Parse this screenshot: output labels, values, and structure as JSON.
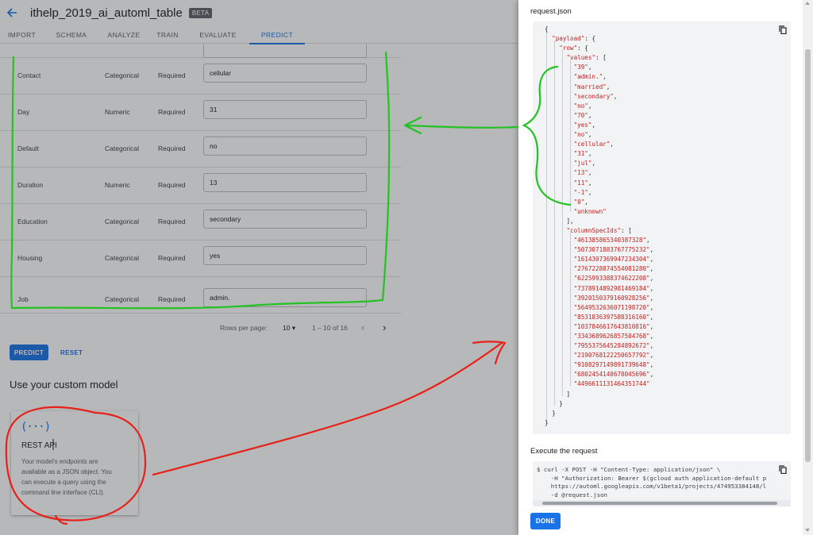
{
  "app": {
    "title": "ithelp_2019_ai_automl_table",
    "badge": "BETA",
    "tabs": [
      {
        "label": "IMPORT"
      },
      {
        "label": "SCHEMA"
      },
      {
        "label": "ANALYZE"
      },
      {
        "label": "TRAIN"
      },
      {
        "label": "EVALUATE"
      },
      {
        "label": "PREDICT",
        "active": true
      }
    ]
  },
  "fields": [
    {
      "name": "Contact",
      "type": "Categorical",
      "required": "Required",
      "value": "cellular"
    },
    {
      "name": "Day",
      "type": "Numeric",
      "required": "Required",
      "value": "31"
    },
    {
      "name": "Default",
      "type": "Categorical",
      "required": "Required",
      "value": "no"
    },
    {
      "name": "Duration",
      "type": "Numeric",
      "required": "Required",
      "value": "13"
    },
    {
      "name": "Education",
      "type": "Categorical",
      "required": "Required",
      "value": "secondary"
    },
    {
      "name": "Housing",
      "type": "Categorical",
      "required": "Required",
      "value": "yes"
    },
    {
      "name": "Job",
      "type": "Categorical",
      "required": "Required",
      "value": "admin."
    }
  ],
  "pagination": {
    "rows_per_page_label": "Rows per page:",
    "rows_per_page": "10",
    "range": "1 – 10 of 16"
  },
  "actions": {
    "predict": "PREDICT",
    "reset": "RESET"
  },
  "custom_model": {
    "title": "Use your custom model",
    "card_icon": "(···)",
    "card_title": "REST API",
    "card_desc": "Your model's endpoints are available as a JSON object. You can execute a query using the command line interface (CLI)."
  },
  "panel": {
    "title": "request.json",
    "json_values": [
      "39",
      "admin.",
      "married",
      "secondary",
      "no",
      "70",
      "yes",
      "no",
      "cellular",
      "31",
      "jul",
      "13",
      "11",
      "-1",
      "0",
      "unknown"
    ],
    "column_spec_ids": [
      "461385865340387328",
      "5073071883767775232",
      "1614307369947234304",
      "2767228874554081280",
      "6225993388374622208",
      "7378914892981469184",
      "3920150379160928256",
      "5649532636071198720",
      "8531836397588316160",
      "1037846617643810816",
      "3343689626857504768",
      "7955375645284892672",
      "2190768122250657792",
      "9108297149891739648",
      "6802454140678045696",
      "4496611131464351744"
    ],
    "execute_title": "Execute the request",
    "command_lines": [
      "$ curl -X POST -H \"Content-Type: application/json\" \\",
      "    -H \"Authorization: Bearer $(gcloud auth application-default p",
      "    https://automl.googleapis.com/v1beta1/projects/474953384148/l",
      "    -d @request.json"
    ],
    "done": "DONE"
  },
  "icons": {
    "back": "arrow-back-icon",
    "copy": "content-copy-icon",
    "rest": "api-braces-icon",
    "dropdown": "caret-down-icon",
    "prev": "chevron-left-icon",
    "next": "chevron-right-icon"
  },
  "colors": {
    "accent": "#1a73e8",
    "json_string": "#c5221f",
    "annotation_green": "#22c322",
    "annotation_red": "#e8201a"
  }
}
